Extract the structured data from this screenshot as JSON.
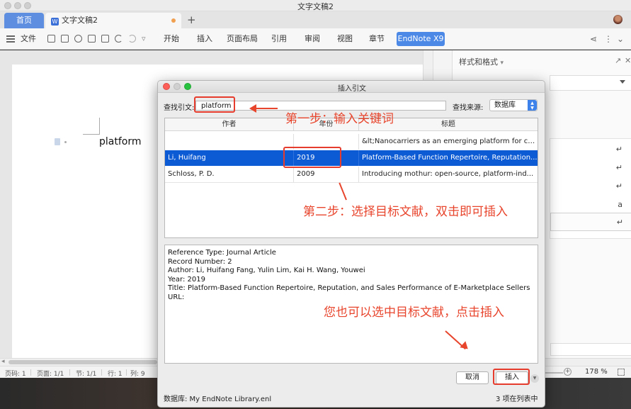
{
  "window": {
    "title": "文字文稿2"
  },
  "tabs": {
    "home": "首页",
    "doc": "文字文稿2",
    "add": "+"
  },
  "ribbon": {
    "file": "文件",
    "menus": [
      "开始",
      "插入",
      "页面布局",
      "引用",
      "审阅",
      "视图",
      "章节"
    ],
    "endnote": "EndNote X9"
  },
  "document": {
    "text": "platform"
  },
  "right_panel": {
    "title": "样式和格式",
    "title_arrow": "▾",
    "pilcrow": "↵",
    "sample_a": "a"
  },
  "statusbar": {
    "page_num": "页码: 1",
    "pages": "页面: 1/1",
    "section": "节: 1/1",
    "row": "行: 1",
    "col": "列: 9",
    "zoom": "178 %"
  },
  "dialog": {
    "title": "插入引文",
    "search_label": "查找引文:",
    "search_value": "platform",
    "source_label": "查找来源:",
    "source_value": "数据库",
    "columns": {
      "author": "作者",
      "year": "年份",
      "title": "标题"
    },
    "rows": [
      {
        "author": "",
        "year": "",
        "title": "&lt;Nanocarriers as an emerging platform for ca..."
      },
      {
        "author": "Li, Huifang",
        "year": "2019",
        "title": "Platform-Based Function Repertoire, Reputation..."
      },
      {
        "author": "Schloss, P. D.",
        "year": "2009",
        "title": "Introducing mothur: open-source, platform-ind..."
      }
    ],
    "details": {
      "type": "Reference Type: Journal Article",
      "record": "Record Number: 2",
      "author": "Author: Li, Huifang Fang, Yulin Lim, Kai H. Wang, Youwei",
      "year": "Year: 2019",
      "title": "Title: Platform-Based Function Repertoire, Reputation, and Sales Performance of E-Marketplace Sellers",
      "url": "URL:"
    },
    "cancel": "取消",
    "insert": "插入",
    "library": "数据库: My EndNote Library.enl",
    "count": "3 项在列表中"
  },
  "annotations": {
    "step1": "第一步：输入关键词",
    "step2": "第二步：选择目标文献，双击即可插入",
    "step3": "您也可以选中目标文献，点击插入"
  },
  "colors": {
    "accent": "#4c89e6",
    "selection": "#0d5bd4",
    "annotation": "#e8452d"
  }
}
